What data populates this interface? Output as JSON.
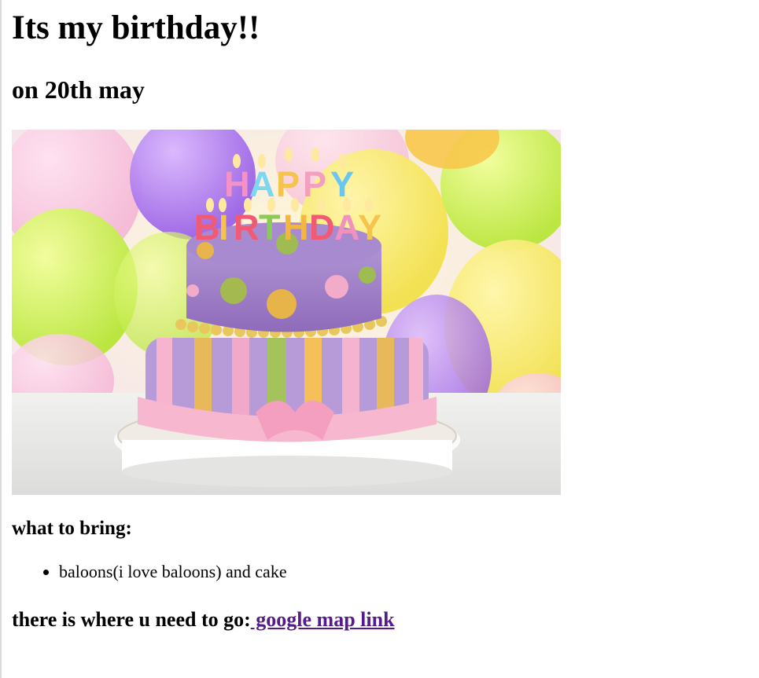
{
  "page": {
    "title": "Its my birthday!!",
    "date": "on 20th may"
  },
  "image": {
    "candles_top": "HAPPY",
    "candles_bottom": "BIRTHDAY"
  },
  "bring": {
    "heading": "what to bring:",
    "items": [
      "baloons(i love baloons) and cake"
    ]
  },
  "location": {
    "label": "there is where u need to go:",
    "link_text": " google map link"
  },
  "colors": {
    "link_visited": "#551a8b",
    "text": "#000000"
  }
}
